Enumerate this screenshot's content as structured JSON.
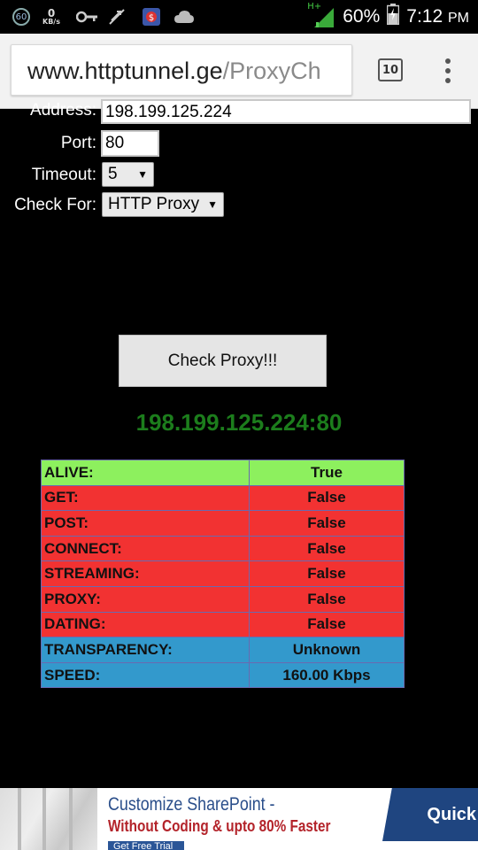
{
  "status_bar": {
    "notification_count": "60",
    "speed_value": "0",
    "speed_unit": "KB/s",
    "network_type": "H+",
    "battery": "60%",
    "time": "7:12",
    "ampm": "PM"
  },
  "browser": {
    "url_host": "www.httptunnel.ge",
    "url_path": "/ProxyCh",
    "tab_count": "10"
  },
  "form": {
    "address_label": "Address:",
    "address_value": "198.199.125.224",
    "port_label": "Port:",
    "port_value": "80",
    "timeout_label": "Timeout:",
    "timeout_value": "5",
    "checkfor_label": "Check For:",
    "checkfor_value": "HTTP Proxy",
    "button_label": "Check Proxy!!!"
  },
  "result": {
    "host": "198.199.125.224:80",
    "rows": [
      {
        "key": "ALIVE:",
        "value": "True",
        "status": "green"
      },
      {
        "key": "GET:",
        "value": "False",
        "status": "red"
      },
      {
        "key": "POST:",
        "value": "False",
        "status": "red"
      },
      {
        "key": "CONNECT:",
        "value": "False",
        "status": "red"
      },
      {
        "key": "STREAMING:",
        "value": "False",
        "status": "red"
      },
      {
        "key": "PROXY:",
        "value": "False",
        "status": "red"
      },
      {
        "key": "DATING:",
        "value": "False",
        "status": "red"
      },
      {
        "key": "TRANSPARENCY:",
        "value": "Unknown",
        "status": "blue"
      },
      {
        "key": "SPEED:",
        "value": "160.00 Kbps",
        "status": "blue"
      }
    ]
  },
  "ad": {
    "line1": "Customize SharePoint -",
    "line2": "Without Coding & upto 80% Faster",
    "cta": "Get Free Trial",
    "brand": "Quick"
  },
  "colors": {
    "alive": "#8df05e",
    "false": "#f23232",
    "info": "#3399cc",
    "host_text": "#1c7d1c"
  }
}
